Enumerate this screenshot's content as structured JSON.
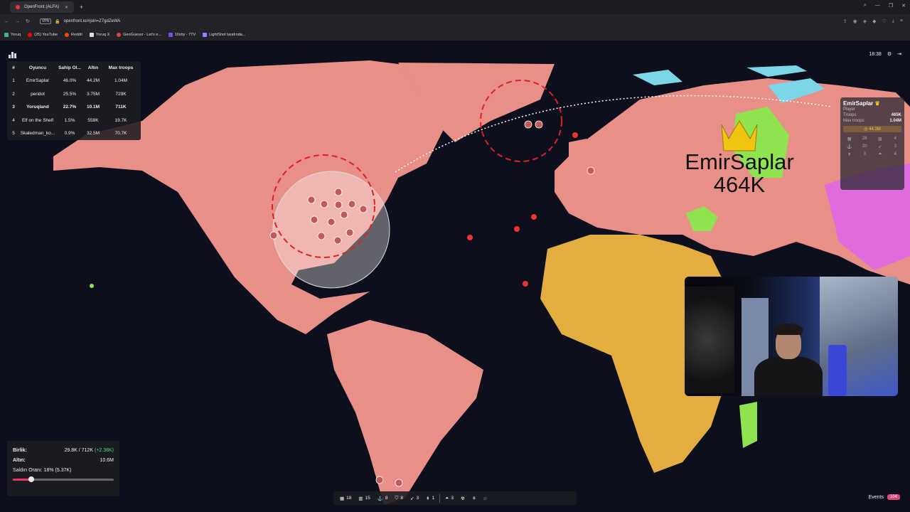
{
  "browser": {
    "tab_title": "OpenFront (ALFA)",
    "url": "openfront.io/#join=Z7gdZeWA",
    "vpn": "VPN",
    "bookmarks": [
      "Yoruq",
      "(25) YouTube",
      "Reddit",
      "Yoruq X",
      "GeoGuessr - Let's e...",
      "1fishy - 7TV",
      "LightShot tarafında..."
    ],
    "bookmark_colors": [
      "#43b581",
      "#ff0000",
      "#ff4500",
      "#dddddd",
      "#d44",
      "#7a4ee0",
      "#8888ff"
    ]
  },
  "leaderboard": {
    "headers": [
      "#",
      "Oyuncu",
      "Sahip Ol...",
      "Altın",
      "Max troops"
    ],
    "rows": [
      [
        "1",
        "EmirSaplar",
        "46.0%",
        "44.2M",
        "1.04M"
      ],
      [
        "2",
        "peridot",
        "25.5%",
        "3.75M",
        "729K"
      ],
      [
        "3",
        "Yoruqland",
        "22.7%",
        "10.1M",
        "711K"
      ],
      [
        "4",
        "Elf on the Shelf",
        "1.5%",
        "558K",
        "19.7K"
      ],
      [
        "5",
        "Skaledman_ko...",
        "0.9%",
        "32.5M",
        "70.7K"
      ]
    ],
    "highlighted_row": 2
  },
  "clock": "18:38",
  "player_panel": {
    "name": "EmirSaplar",
    "type": "Player",
    "troops_label": "Troops",
    "troops": "465K",
    "max_troops_label": "Max troops",
    "max_troops": "1.04M",
    "gold": "44.2M",
    "grid": [
      "26",
      "4",
      "20",
      "3",
      "3",
      "4"
    ]
  },
  "map_label": {
    "name": "EmirSaplar",
    "troops": "464K"
  },
  "stats": {
    "birlik_label": "Birlik:",
    "birlik_value": "29.8K / 712K",
    "birlik_gain": "(+2.38K)",
    "altin_label": "Altın:",
    "altin_value": "10.6M",
    "attack_label": "Saldırı Oranı: 18% (5.37K)",
    "attack_ratio": 0.18
  },
  "toolbar": {
    "items": [
      {
        "icon": "city-icon",
        "count": "18"
      },
      {
        "icon": "factory-icon",
        "count": "15"
      },
      {
        "icon": "port-icon",
        "count": "8"
      },
      {
        "icon": "defense-post-icon",
        "count": "8"
      },
      {
        "icon": "missile-silo-icon",
        "count": "3"
      },
      {
        "icon": "sam-launcher-icon",
        "count": "1"
      },
      {
        "icon": "warship-icon",
        "count": "3"
      }
    ]
  },
  "events": {
    "label": "Events",
    "count": "104"
  },
  "colors": {
    "ocean": "#0e0f1d",
    "americas": "#e88f88",
    "africa": "#e3ad3f",
    "green_player": "#8fe34f",
    "magenta_player": "#e06bdc",
    "cyan_player": "#7bd7e8"
  }
}
